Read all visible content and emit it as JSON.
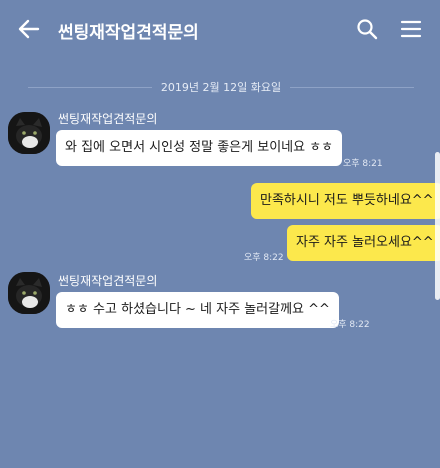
{
  "header": {
    "title": "썬팅재작업견적문의",
    "back_icon": "arrow-left-icon",
    "search_icon": "search-icon",
    "menu_icon": "hamburger-menu-icon"
  },
  "date_divider": "2019년 2월 12일 화요일",
  "messages": [
    {
      "direction": "incoming",
      "sender": "썬팅재작업견적문의",
      "text": "와 집에 오면서 시인성 정말 좋은게 보이네요 ㅎㅎ",
      "time": "오후 8:21"
    },
    {
      "direction": "outgoing",
      "text": "만족하시니 저도 뿌듯하네요^^",
      "time": ""
    },
    {
      "direction": "outgoing",
      "text": "자주 자주 놀러오세요^^",
      "time": "오후 8:22"
    },
    {
      "direction": "incoming",
      "sender": "썬팅재작업견적문의",
      "text": "ㅎㅎ 수고 하셨습니다 ~ 네 자주 놀러갈께요 ^^",
      "time": "오후 8:22"
    }
  ],
  "colors": {
    "background": "#6e86b0",
    "incoming_bubble": "#ffffff",
    "outgoing_bubble": "#fce84c"
  }
}
